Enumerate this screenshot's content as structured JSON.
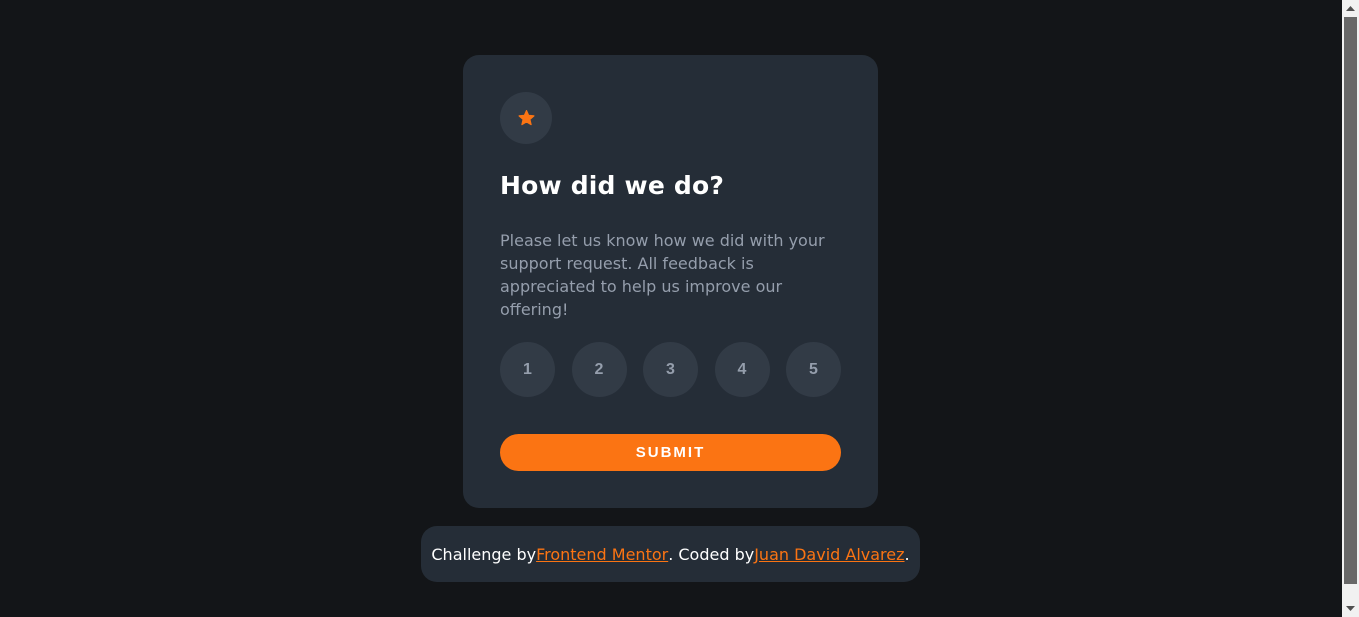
{
  "card": {
    "icon": "star-icon",
    "title": "How did we do?",
    "description": "Please let us know how we did with your support request. All feedback is appreciated to help us improve our offering!",
    "ratings": [
      "1",
      "2",
      "3",
      "4",
      "5"
    ],
    "submit_label": "SUBMIT"
  },
  "attribution": {
    "prefix": "Challenge by",
    "link1": "Frontend Mentor",
    "middle": ". Coded by",
    "link2": "Juan David Alvarez",
    "suffix": "."
  },
  "colors": {
    "background": "#131518",
    "card": "#252d37",
    "accent": "#fb7413",
    "muted_text": "#959eac",
    "circle": "#323b46"
  }
}
